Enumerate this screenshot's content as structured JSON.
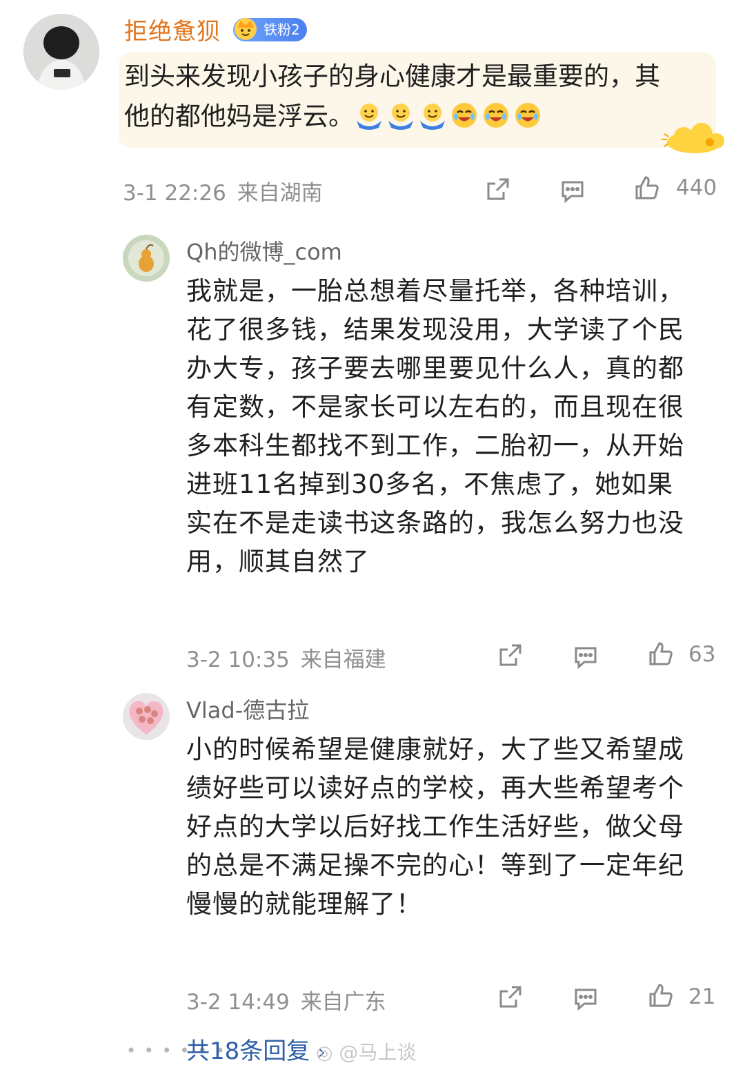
{
  "top_comment": {
    "username": "拒绝惫狈",
    "badge": "铁粉2",
    "text": "到头来发现小孩子的身心健康才是最重要的，其他的都他妈是浮云。",
    "time": "3-1 22:26",
    "location": "来自湖南",
    "likes": "440",
    "emoji_icons": [
      "hug-emoji",
      "hug-emoji",
      "hug-emoji",
      "laugh-cry-emoji",
      "laugh-cry-emoji",
      "laugh-cry-emoji"
    ]
  },
  "replies": [
    {
      "username": "Qh的微博_com",
      "text": "我就是，一胎总想着尽量托举，各种培训，花了很多钱，结果发现没用，大学读了个民办大专，孩子要去哪里要见什么人，真的都有定数，不是家长可以左右的，而且现在很多本科生都找不到工作，二胎初一，从开始进班11名掉到30多名，不焦虑了，她如果实在不是走读书这条路的，我怎么努力也没用，顺其自然了",
      "time": "3-2 10:35",
      "location": "来自福建",
      "likes": "63"
    },
    {
      "username": "Vlad-德古拉",
      "text": "小的时候希望是健康就好，大了些又希望成绩好些可以读好点的学校，再大些希望考个好点的大学以后好找工作生活好些，做父母的总是不满足操不完的心！等到了一定年纪慢慢的就能理解了！",
      "time": "3-2 14:49",
      "location": "来自广东",
      "likes": "21"
    }
  ],
  "more_replies": "共18条回复",
  "watermark": "@马上谈",
  "colors": {
    "username_orange": "#e2761e",
    "link_blue": "#2f5fa8",
    "meta_gray": "#8f8f8f",
    "bubble_bg": "#fdf7e9"
  }
}
